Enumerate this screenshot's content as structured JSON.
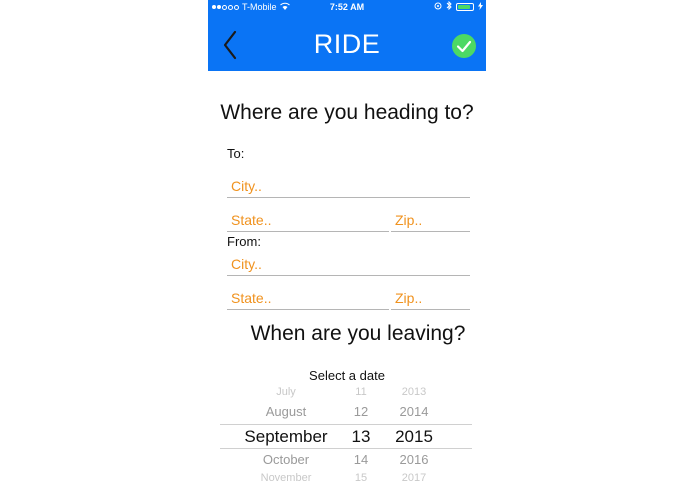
{
  "status_bar": {
    "carrier": "T-Mobile",
    "time": "7:52 AM",
    "battery_level": 0.85
  },
  "nav": {
    "title": "RIDE",
    "back_icon": "chevron-left-icon",
    "confirm_icon": "checkmark-icon"
  },
  "destination": {
    "heading": "Where are you heading to?",
    "to_label": "To:",
    "from_label": "From:",
    "to_city_placeholder": "City..",
    "to_state_placeholder": "State..",
    "to_zip_placeholder": "Zip..",
    "from_city_placeholder": "City..",
    "from_state_placeholder": "State..",
    "from_zip_placeholder": "Zip.."
  },
  "date": {
    "heading": "When are you leaving?",
    "picker_label": "Select a date",
    "months": [
      "July",
      "August",
      "September",
      "October",
      "November"
    ],
    "days": [
      "11",
      "12",
      "13",
      "14",
      "15"
    ],
    "years": [
      "2013",
      "2014",
      "2015",
      "2016",
      "2017"
    ],
    "selected": {
      "month": "September",
      "day": "13",
      "year": "2015"
    }
  },
  "colors": {
    "nav_blue": "#0a74f5",
    "accent_orange": "#f0921e",
    "confirm_green": "#4cd964"
  }
}
